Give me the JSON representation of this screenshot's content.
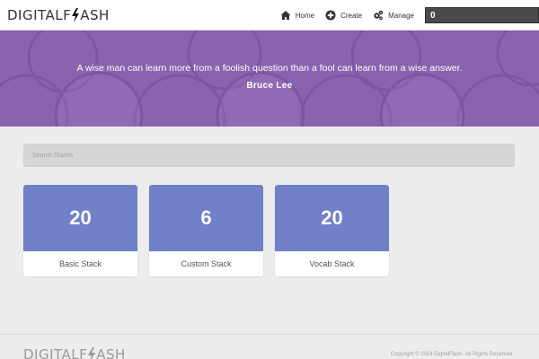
{
  "brand": {
    "left": "DIGITALF",
    "right": "ASH"
  },
  "nav": [
    {
      "label": "Home",
      "icon": "home-icon"
    },
    {
      "label": "Create",
      "icon": "plus-circle-icon"
    },
    {
      "label": "Manage",
      "icon": "gears-icon"
    }
  ],
  "counter": {
    "value": "0"
  },
  "hero": {
    "quote": "A wise man can learn more from a foolish question than a fool can learn from a wise answer.",
    "author": "Bruce Lee",
    "color": "#8a63ae"
  },
  "search": {
    "placeholder": "Search Stacks",
    "value": ""
  },
  "stacks": [
    {
      "count": "20",
      "name": "Basic Stack"
    },
    {
      "count": "6",
      "name": "Custom Stack"
    },
    {
      "count": "20",
      "name": "Vocab Stack"
    }
  ],
  "footer": {
    "copyright": "Copyright © 2014 DigitalFlash. All Rights Reserved."
  },
  "colors": {
    "card_accent": "#7080c9",
    "counter_bg": "#474a48"
  }
}
